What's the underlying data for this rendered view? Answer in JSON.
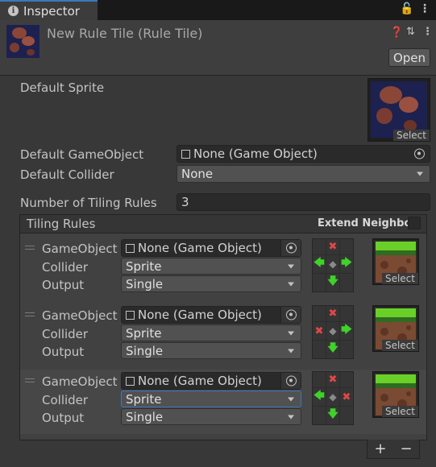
{
  "tab": {
    "label": "Inspector"
  },
  "header": {
    "title": "New Rule Tile (Rule Tile)",
    "open_label": "Open"
  },
  "props": {
    "default_sprite_label": "Default Sprite",
    "default_gameobject_label": "Default GameObject",
    "default_gameobject_value": "None (Game Object)",
    "default_collider_label": "Default Collider",
    "default_collider_value": "None",
    "num_rules_label": "Number of Tiling Rules",
    "num_rules_value": "3",
    "select_label": "Select"
  },
  "tiling": {
    "header_label": "Tiling Rules",
    "extend_label": "Extend Neighbor",
    "rules": [
      {
        "gameobject_label": "GameObject",
        "gameobject_value": "None (Game Object)",
        "collider_label": "Collider",
        "collider_value": "Sprite",
        "output_label": "Output",
        "output_value": "Single",
        "select_label": "Select",
        "grid": [
          "",
          "red-x",
          "",
          "green-left",
          "center",
          "green-right",
          "",
          "green-down",
          ""
        ]
      },
      {
        "gameobject_label": "GameObject",
        "gameobject_value": "None (Game Object)",
        "collider_label": "Collider",
        "collider_value": "Sprite",
        "output_label": "Output",
        "output_value": "Single",
        "select_label": "Select",
        "grid": [
          "",
          "red-x",
          "",
          "red-x",
          "center",
          "green-right",
          "",
          "green-down",
          ""
        ]
      },
      {
        "gameobject_label": "GameObject",
        "gameobject_value": "None (Game Object)",
        "collider_label": "Collider",
        "collider_value": "Sprite",
        "output_label": "Output",
        "output_value": "Single",
        "select_label": "Select",
        "grid": [
          "",
          "red-x",
          "",
          "green-left",
          "center",
          "red-x",
          "",
          "green-down",
          ""
        ]
      }
    ]
  },
  "footer": {
    "add": "+",
    "remove": "−"
  },
  "colors": {
    "accent": "#3a79bb",
    "green_arrow": "#3fd22a",
    "red_x": "#e04848"
  }
}
